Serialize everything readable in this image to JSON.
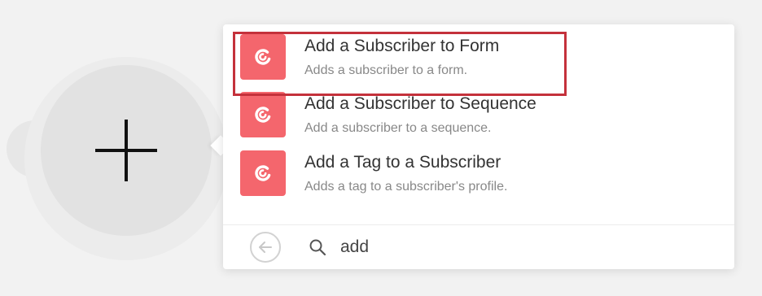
{
  "module": {
    "icon": "plus-icon"
  },
  "menu": {
    "items": [
      {
        "title": "Add a Subscriber to Form",
        "description": "Adds a subscriber to a form.",
        "icon": "convertkit-icon",
        "highlighted": true
      },
      {
        "title": "Add a Subscriber to Sequence",
        "description": "Add a subscriber to a sequence.",
        "icon": "convertkit-icon",
        "highlighted": false
      },
      {
        "title": "Add a Tag to a Subscriber",
        "description": "Adds a tag to a subscriber's profile.",
        "icon": "convertkit-icon",
        "highlighted": false
      }
    ],
    "app_color": "#f4666d",
    "highlight_color": "#c4313b"
  },
  "search": {
    "back_icon": "arrow-left-icon",
    "search_icon": "search-icon",
    "value": "add"
  }
}
